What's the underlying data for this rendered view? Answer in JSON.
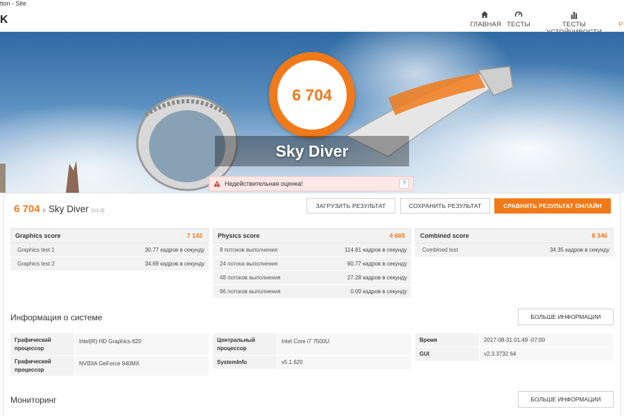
{
  "window": {
    "title": "tion - Site"
  },
  "nav": {
    "logo": "K",
    "items": [
      {
        "label": "ГЛАВНАЯ",
        "icon": "home-icon"
      },
      {
        "label": "ТЕСТЫ",
        "icon": "gauge-icon"
      },
      {
        "label": "ТЕСТЫ УСТОЙЧИВОСТИ",
        "icon": "bar-chart-icon"
      },
      {
        "label": "Р",
        "icon": ""
      }
    ]
  },
  "hero": {
    "score": "6 704",
    "title": "Sky Diver",
    "warning": "Недействительная оценка!",
    "help": "?"
  },
  "result": {
    "score": "6 704",
    "score_unit": "В",
    "name": "Sky Diver",
    "version": "(V1.0)",
    "buttons": {
      "upload": "ЗАГРУЗИТЬ РЕЗУЛЬТАТ",
      "save": "СОХРАНИТЬ РЕЗУЛЬТАТ",
      "compare": "СРАВНИТЬ РЕЗУЛЬТАТ ОНЛАЙН"
    }
  },
  "scores": {
    "graphics": {
      "title": "Graphics score",
      "value": "7 142",
      "rows": [
        {
          "label": "Graphics test 1",
          "value": "30.77 кадров в секунду"
        },
        {
          "label": "Graphics test 2",
          "value": "34.69 кадров в секунду"
        }
      ]
    },
    "physics": {
      "title": "Physics score",
      "value": "4 665",
      "rows": [
        {
          "label": "8 потоков выполнения",
          "value": "114.81 кадров в секунду"
        },
        {
          "label": "24 потока выполнения",
          "value": "60.77 кадров в секунду"
        },
        {
          "label": "48 потоков выполнения",
          "value": "27.28 кадров в секунду"
        },
        {
          "label": "96 потоков выполнения",
          "value": "0.00 кадров в секунду"
        }
      ]
    },
    "combined": {
      "title": "Combined score",
      "value": "8 346",
      "rows": [
        {
          "label": "Combined test",
          "value": "34.35 кадров в секунду"
        }
      ]
    }
  },
  "system": {
    "title": "Информация о системе",
    "more": "БОЛЬШЕ ИНФОРМАЦИИ",
    "col1": [
      {
        "key": "Графический процессор",
        "value": "Intel(R) HD Graphics 620"
      },
      {
        "key": "Графический процессор",
        "value": "NVIDIA GeForce 940MX"
      }
    ],
    "col2": [
      {
        "key": "Центральный процессор",
        "value": "Intel Core i7 7500U"
      },
      {
        "key": "SystemInfo",
        "value": "v5.1.620"
      }
    ],
    "col3": [
      {
        "key": "Время",
        "value": "2017-08-31 01:49 -07:00"
      },
      {
        "key": "GUI",
        "value": "v2.3.3732 64"
      }
    ]
  },
  "monitoring": {
    "title": "Мониторинг",
    "more": "БОЛЬШЕ ИНФОРМАЦИИ"
  },
  "colors": {
    "accent": "#f07a1a",
    "warning_bg": "#fbe7e6"
  }
}
